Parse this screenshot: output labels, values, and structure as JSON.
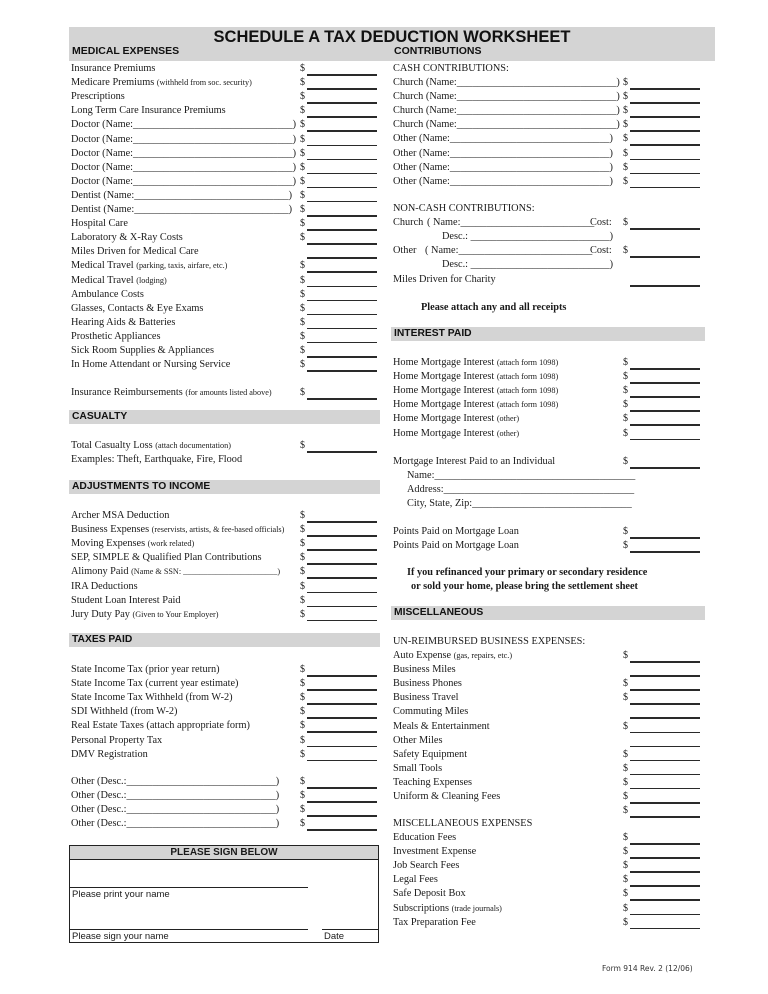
{
  "title": "SCHEDULE A TAX DEDUCTION WORKSHEET",
  "currency_symbol": "$",
  "medical": {
    "heading": "MEDICAL EXPENSES",
    "items": [
      {
        "label": "Insurance Premiums",
        "note": ""
      },
      {
        "label": "Medicare Premiums",
        "note": "(withheld from soc. security)"
      },
      {
        "label": "Prescriptions",
        "note": ""
      },
      {
        "label": "Long Term Care Insurance Premiums",
        "note": ""
      },
      {
        "label": "Doctor (Name:_______________________________)",
        "note": ""
      },
      {
        "label": "Doctor (Name:_______________________________)",
        "note": ""
      },
      {
        "label": "Doctor (Name:_______________________________)",
        "note": ""
      },
      {
        "label": "Doctor (Name:_______________________________)",
        "note": ""
      },
      {
        "label": "Doctor (Name:_______________________________)",
        "note": ""
      },
      {
        "label": "Dentist (Name:______________________________)",
        "note": ""
      },
      {
        "label": "Dentist (Name:______________________________)",
        "note": ""
      },
      {
        "label": "Hospital Care",
        "note": ""
      },
      {
        "label": "Laboratory & X-Ray Costs",
        "note": ""
      },
      {
        "label": "Miles Driven for Medical Care",
        "note": "",
        "no_dollar": true
      },
      {
        "label": "Medical Travel",
        "note": "(parking, taxis, airfare, etc.)"
      },
      {
        "label": "Medical Travel",
        "note": "(lodging)"
      },
      {
        "label": "Ambulance Costs",
        "note": ""
      },
      {
        "label": "Glasses, Contacts & Eye Exams",
        "note": ""
      },
      {
        "label": "Hearing Aids & Batteries",
        "note": ""
      },
      {
        "label": "Prosthetic Appliances",
        "note": ""
      },
      {
        "label": "Sick Room Supplies & Appliances",
        "note": ""
      },
      {
        "label": "In Home Attendant or Nursing Service",
        "note": ""
      }
    ],
    "reimbursement": {
      "label": "Insurance Reimbursements",
      "note": "(for amounts listed above)"
    }
  },
  "casualty": {
    "heading": "CASUALTY",
    "total": {
      "label": "Total Casualty Loss",
      "note": "(attach documentation)"
    },
    "examples": "Examples: Theft, Earthquake, Fire, Flood"
  },
  "adjustments": {
    "heading": "ADJUSTMENTS TO INCOME",
    "items": [
      {
        "label": "Archer MSA Deduction",
        "note": ""
      },
      {
        "label": "Business Expenses",
        "note": "(reservists, artists, & fee-based officials)"
      },
      {
        "label": "Moving Expenses",
        "note": "(work related)"
      },
      {
        "label": "SEP, SIMPLE & Qualified Plan Contributions",
        "note": ""
      },
      {
        "label": "Alimony Paid",
        "note": "(Name & SSN: _______________________)"
      },
      {
        "label": "IRA Deductions",
        "note": ""
      },
      {
        "label": "Student Loan Interest Paid",
        "note": ""
      },
      {
        "label": "Jury Duty Pay",
        "note": "(Given to Your Employer)"
      }
    ]
  },
  "taxes": {
    "heading": "TAXES PAID",
    "items": [
      {
        "label": "State Income Tax (prior year return)"
      },
      {
        "label": "State Income Tax (current year estimate)"
      },
      {
        "label": "State Income Tax Withheld (from W-2)"
      },
      {
        "label": "SDI Withheld (from W-2)"
      },
      {
        "label": "Real Estate Taxes (attach appropriate form)"
      },
      {
        "label": "Personal Property Tax"
      },
      {
        "label": "DMV Registration"
      }
    ],
    "others": [
      {
        "label": "Other (Desc.:_____________________________)"
      },
      {
        "label": "Other (Desc.:_____________________________)"
      },
      {
        "label": "Other (Desc.:_____________________________)"
      },
      {
        "label": "Other (Desc.:_____________________________)"
      }
    ]
  },
  "sign": {
    "heading": "PLEASE SIGN BELOW",
    "print_label": "Please print your name",
    "sign_label": "Please sign your name",
    "date_label": "Date"
  },
  "contributions": {
    "heading": "CONTRIBUTIONS",
    "cash_heading": "CASH CONTRIBUTIONS:",
    "cash_items": [
      {
        "label": "Church (Name:_______________________________)"
      },
      {
        "label": "Church (Name:_______________________________)"
      },
      {
        "label": "Church (Name:_______________________________)"
      },
      {
        "label": "Church (Name:_______________________________)"
      },
      {
        "label": "Other (Name:_______________________________)"
      },
      {
        "label": "Other (Name:_______________________________)"
      },
      {
        "label": "Other (Name:_______________________________)"
      },
      {
        "label": "Other (Name:_______________________________)"
      }
    ],
    "noncash_heading": "NON-CASH CONTRIBUTIONS:",
    "noncash_items": [
      {
        "type": "Church",
        "name_label": "( Name:__________________________",
        "cost_label": "Cost:",
        "desc_label": "Desc.: ___________________________)"
      },
      {
        "type": "Other",
        "name_label": "( Name:__________________________",
        "cost_label": "Cost:",
        "desc_label": "Desc.: ___________________________)"
      }
    ],
    "miles_label": "Miles Driven for Charity",
    "receipts_note": "Please attach any and all receipts"
  },
  "interest": {
    "heading": "INTEREST PAID",
    "items": [
      {
        "label": "Home Mortgage Interest",
        "note": "(attach form 1098)"
      },
      {
        "label": "Home Mortgage Interest",
        "note": "(attach form 1098)"
      },
      {
        "label": "Home Mortgage Interest",
        "note": "(attach form 1098)"
      },
      {
        "label": "Home Mortgage Interest",
        "note": "(attach form 1098)"
      },
      {
        "label": "Home Mortgage Interest",
        "note": "(other)"
      },
      {
        "label": "Home Mortgage Interest",
        "note": "(other)"
      }
    ],
    "individual": {
      "label": "Mortgage Interest Paid to an Individual",
      "name_label": "Name:_______________________________________",
      "address_label": "Address:_____________________________________",
      "city_label": "City, State, Zip:_______________________________"
    },
    "points": [
      {
        "label": "Points Paid on Mortgage Loan"
      },
      {
        "label": "Points Paid on Mortgage Loan"
      }
    ],
    "refinance_note_1": "If you refinanced your primary or secondary residence",
    "refinance_note_2": "or sold your home, please bring the settlement sheet"
  },
  "misc": {
    "heading": "MISCELLANEOUS",
    "unreimbursed_heading": "UN-REIMBURSED BUSINESS EXPENSES:",
    "unreimbursed_items": [
      {
        "label": "Auto Expense",
        "note": "(gas, repairs, etc.)"
      },
      {
        "label": "Business Miles",
        "note": "",
        "no_dollar": true
      },
      {
        "label": "Business Phones",
        "note": ""
      },
      {
        "label": "Business Travel",
        "note": ""
      },
      {
        "label": "Commuting Miles",
        "note": "",
        "no_dollar": true
      },
      {
        "label": "Meals & Entertainment",
        "note": ""
      },
      {
        "label": "Other Miles",
        "note": "",
        "no_dollar": true
      },
      {
        "label": "Safety Equipment",
        "note": ""
      },
      {
        "label": "Small Tools",
        "note": ""
      },
      {
        "label": "Teaching Expenses",
        "note": ""
      },
      {
        "label": "Uniform & Cleaning Fees",
        "note": ""
      },
      {
        "label": "",
        "note": ""
      }
    ],
    "expenses_heading": "MISCELLANEOUS EXPENSES",
    "expenses_items": [
      {
        "label": "Education Fees",
        "note": ""
      },
      {
        "label": "Investment Expense",
        "note": ""
      },
      {
        "label": "Job Search Fees",
        "note": ""
      },
      {
        "label": "Legal Fees",
        "note": ""
      },
      {
        "label": "Safe Deposit Box",
        "note": ""
      },
      {
        "label": "Subscriptions",
        "note": "(trade journals)"
      },
      {
        "label": "Tax Preparation Fee",
        "note": ""
      }
    ]
  },
  "footer": "Form 914 Rev. 2 (12/06)"
}
